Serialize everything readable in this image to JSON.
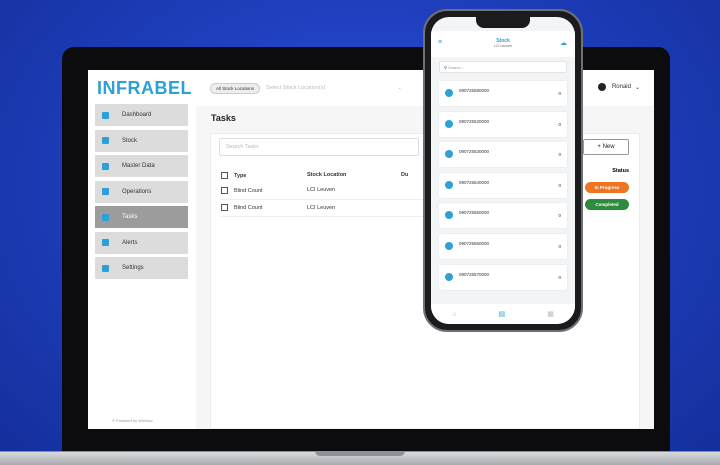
{
  "colors": {
    "background": "#1f3fbf",
    "brand": "#2da1d6",
    "in_progress": "#ee7622",
    "completed": "#2e8a3d"
  },
  "app": {
    "logo": "INFRABEL",
    "powered_by": "© Powered by Weblarz"
  },
  "sidebar": {
    "items": [
      {
        "label": "Dashboard",
        "icon": "dashboard-icon",
        "color": "#2da1d6"
      },
      {
        "label": "Stock",
        "icon": "box-icon",
        "color": "#2da1d6"
      },
      {
        "label": "Master Data",
        "icon": "hierarchy-icon",
        "color": "#2da1d6"
      },
      {
        "label": "Operations",
        "icon": "operations-icon",
        "color": "#2da1d6"
      },
      {
        "label": "Tasks",
        "icon": "tasks-icon",
        "color": "#2da1d6",
        "active": true
      },
      {
        "label": "Alerts",
        "icon": "alert-icon",
        "color": "#2da1d6"
      },
      {
        "label": "Settings",
        "icon": "gear-icon",
        "color": "#2da1d6"
      }
    ]
  },
  "topbar": {
    "location_chip": "All Stock Locations",
    "location_placeholder": "Select Stock Location(s)",
    "user": "Ronald"
  },
  "tasks": {
    "title": "Tasks",
    "search_placeholder": "Search Tasks",
    "new_button": "+ New",
    "columns": {
      "type": "Type",
      "location": "Stock Location",
      "due": "Du",
      "status": "Status"
    },
    "rows": [
      {
        "type": "Blind Count",
        "location": "LCI Leuven",
        "status": "In Progress"
      },
      {
        "type": "Blind Count",
        "location": "LCI Leuven",
        "status": "Completed"
      }
    ]
  },
  "phone": {
    "title": "Stock",
    "subtitle": "LCI Leuven",
    "search_placeholder": "Search...",
    "items": [
      {
        "code": "090725590000",
        "qty": "0"
      },
      {
        "code": "090725520000",
        "qty": "0"
      },
      {
        "code": "090725530000",
        "qty": "0"
      },
      {
        "code": "090725540000",
        "qty": "0"
      },
      {
        "code": "090725550000",
        "qty": "0"
      },
      {
        "code": "090725560000",
        "qty": "0"
      },
      {
        "code": "090725570000",
        "qty": "0"
      }
    ]
  }
}
